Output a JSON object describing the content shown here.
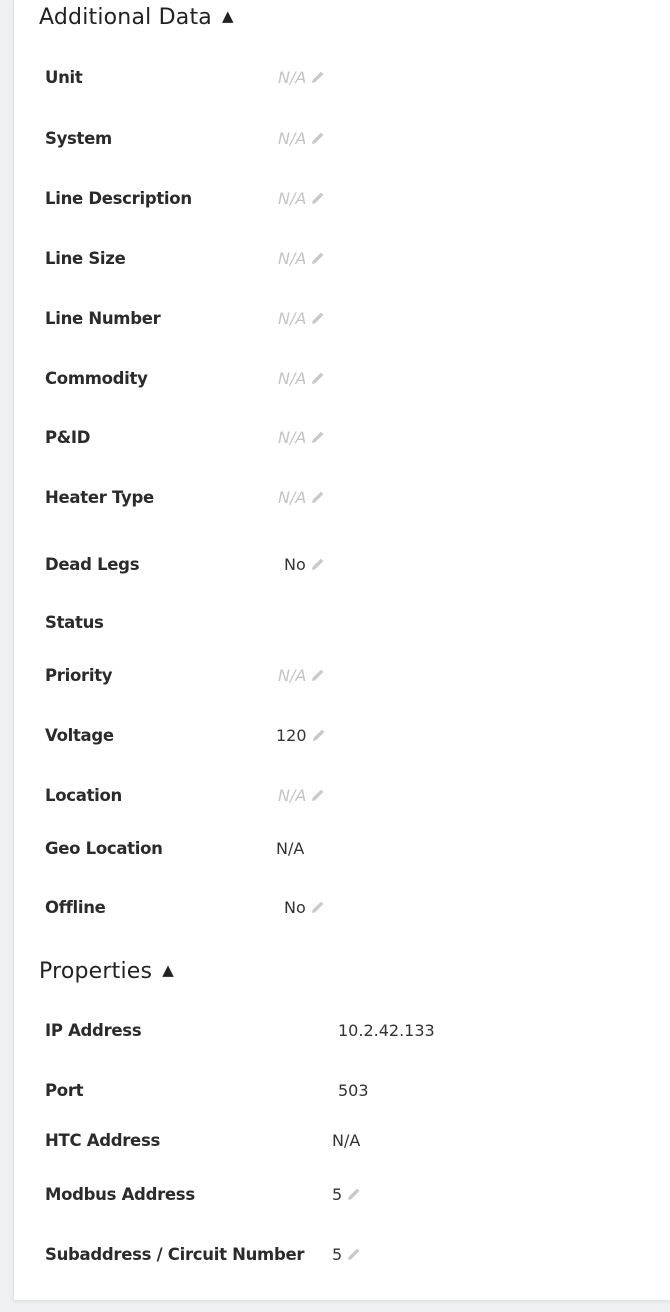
{
  "icons": {
    "collapse": "triangle-up-icon",
    "edit": "pencil-icon"
  },
  "additional_data": {
    "title": "Additional Data",
    "fields": [
      {
        "label": "Unit",
        "value": "N/A",
        "editable": true,
        "na": true
      },
      {
        "label": "System",
        "value": "N/A",
        "editable": true,
        "na": true
      },
      {
        "label": "Line Description",
        "value": "N/A",
        "editable": true,
        "na": true
      },
      {
        "label": "Line Size",
        "value": "N/A",
        "editable": true,
        "na": true
      },
      {
        "label": "Line Number",
        "value": "N/A",
        "editable": true,
        "na": true
      },
      {
        "label": "Commodity",
        "value": "N/A",
        "editable": true,
        "na": true
      },
      {
        "label": "P&ID",
        "value": "N/A",
        "editable": true,
        "na": true
      },
      {
        "label": "Heater Type",
        "value": "N/A",
        "editable": true,
        "na": true
      },
      {
        "label": "Dead Legs",
        "value": "No",
        "editable": true,
        "na": false
      },
      {
        "label": "Status",
        "value": "",
        "editable": false,
        "na": false
      },
      {
        "label": "Priority",
        "value": "N/A",
        "editable": true,
        "na": true
      },
      {
        "label": "Voltage",
        "value": "120",
        "editable": true,
        "na": false
      },
      {
        "label": "Location",
        "value": "N/A",
        "editable": true,
        "na": true
      },
      {
        "label": "Geo Location",
        "value": "N/A",
        "editable": false,
        "na": false
      },
      {
        "label": "Offline",
        "value": "No",
        "editable": true,
        "na": false
      }
    ]
  },
  "properties": {
    "title": "Properties",
    "fields": [
      {
        "label": "IP Address",
        "value": "10.2.42.133",
        "editable": false
      },
      {
        "label": "Port",
        "value": "503",
        "editable": false
      },
      {
        "label": "HTC Address",
        "value": "N/A",
        "editable": false
      },
      {
        "label": "Modbus Address",
        "value": "5",
        "editable": true
      },
      {
        "label": "Subaddress / Circuit Number",
        "value": "5",
        "editable": true
      }
    ]
  }
}
